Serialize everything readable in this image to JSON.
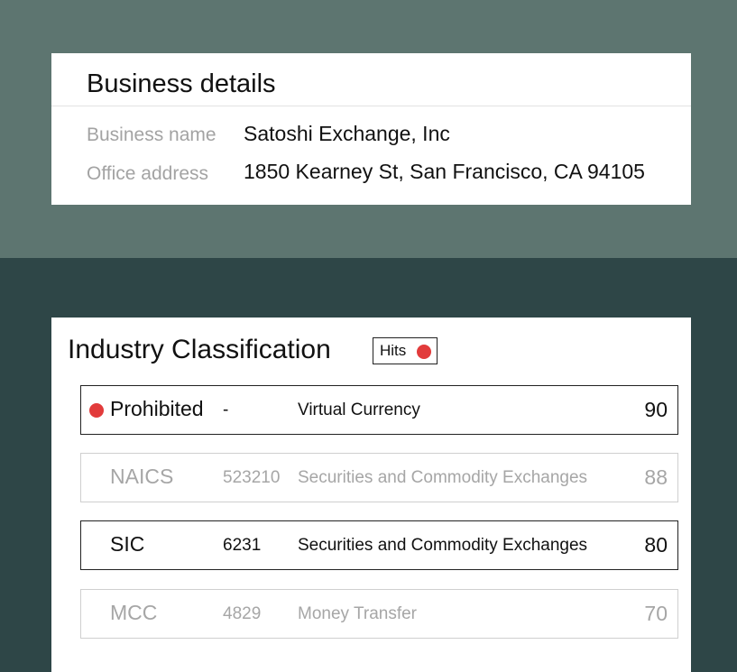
{
  "business": {
    "title": "Business details",
    "fields": [
      {
        "label": "Business name",
        "value": "Satoshi Exchange, Inc"
      },
      {
        "label": "Office address",
        "value": "1850 Kearney St, San Francisco, CA 94105"
      }
    ]
  },
  "industry": {
    "title": "Industry Classification",
    "hits_label": "Hits",
    "rows": [
      {
        "type": "Prohibited",
        "code": "-",
        "description": "Virtual Currency",
        "score": "90",
        "flagged": true,
        "muted": false
      },
      {
        "type": "NAICS",
        "code": "523210",
        "description": "Securities and Commodity Exchanges",
        "score": "88",
        "flagged": false,
        "muted": true
      },
      {
        "type": "SIC",
        "code": "6231",
        "description": "Securities and Commodity Exchanges",
        "score": "80",
        "flagged": false,
        "muted": false
      },
      {
        "type": "MCC",
        "code": "4829",
        "description": "Money Transfer",
        "score": "70",
        "flagged": false,
        "muted": true
      }
    ]
  },
  "colors": {
    "top_band": "#5d7570",
    "bottom_band": "#2e4647",
    "alert_dot": "#e23b3b"
  }
}
